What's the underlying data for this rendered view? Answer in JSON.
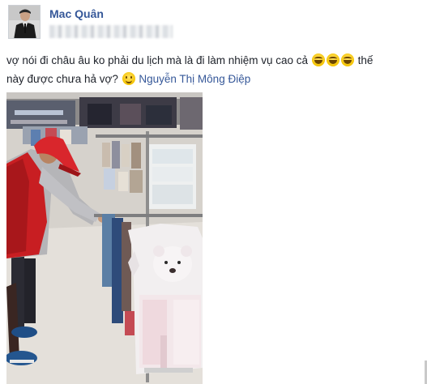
{
  "post": {
    "author_name": "Mac Quân",
    "text_line1_a": "vợ nói đi châu âu ko phải du lịch mà là đi làm nhiệm vụ cao cả",
    "text_line1_b": "thế",
    "text_line2_a": "này được chưa hả vợ?",
    "tagged_user": "Nguyễn Thị Mông Điệp",
    "emoji": [
      "laughing-tears-emoji",
      "laughing-tears-emoji",
      "laughing-tears-emoji",
      "smile-emoji"
    ]
  },
  "colors": {
    "link": "#365899",
    "text": "#1d2129",
    "cap_red": "#d9262c",
    "vest_red": "#c81e22"
  }
}
